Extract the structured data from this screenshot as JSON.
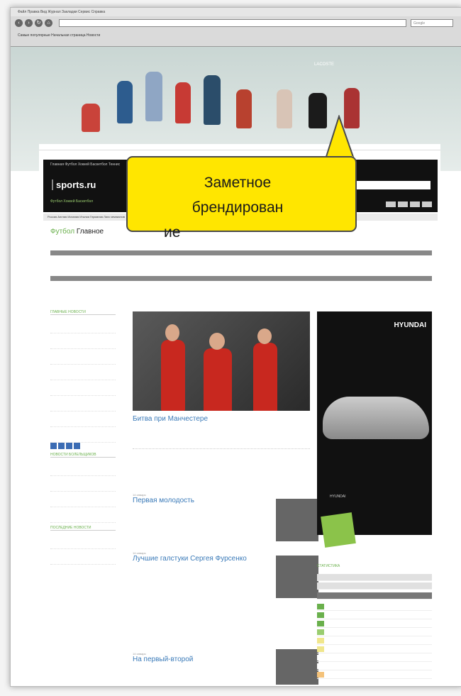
{
  "browser": {
    "menu_text": "Файл  Правка  Вид  Журнал  Закладки  Сервис  Справка",
    "search_placeholder": "Google",
    "bookmarks_text": "Самые популярные  Начальная страница  Новости"
  },
  "branding": {
    "logo": "LACOSTE"
  },
  "site": {
    "name": "sports.ru",
    "tabs": "Главная  Футбол  Хоккей  Баскетбол  Теннис",
    "nav2": "Футбол  Хоккей  Баскетбол",
    "subnav": "Россия  Англия  Испания  Италия  Германия  Лига чемпионов",
    "section_title": "Футбол",
    "section_title_rest": "Главное"
  },
  "left": {
    "main_news_header": "ГЛАВНЫЕ НОВОСТИ",
    "fan_news_header": "НОВОСТИ БОЛЕЛЬЩИКОВ",
    "latest_header": "ПОСЛЕДНИЕ НОВОСТИ"
  },
  "main": {
    "headline": "Битва при Манчестере",
    "news": [
      {
        "title": "Первая молодость",
        "date": "14 января"
      },
      {
        "title": "Лучшие галстуки Сергея Фурсенко",
        "date": "14 января"
      },
      {
        "title": "На первый-второй",
        "date": "14 января"
      }
    ]
  },
  "right": {
    "ad_brand": "HYUNDAI",
    "ad_logo_text": "HYUNDAI",
    "stats_header": "СТАТИСТИКА"
  },
  "callout": {
    "text_line1": "Заметное",
    "text_line2": "брендирован",
    "text_line3": "ие",
    "bg_color": "#ffe600"
  }
}
